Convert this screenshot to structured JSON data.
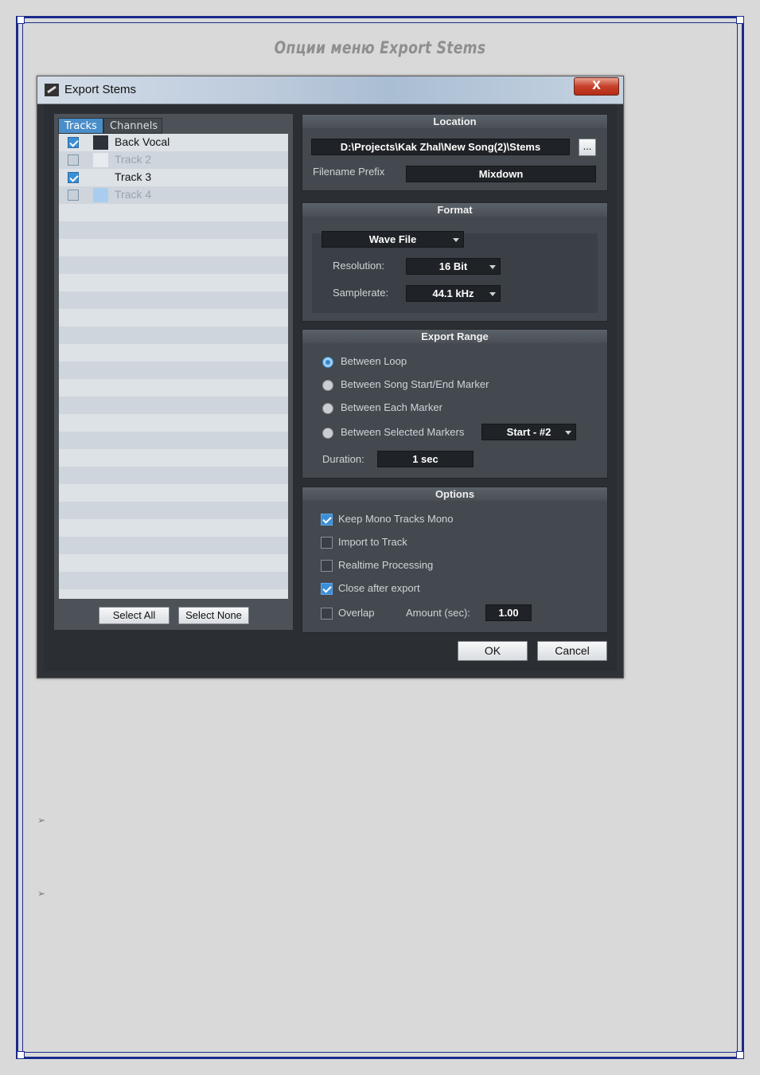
{
  "page": {
    "heading": "Опции меню Export Stems",
    "bullets": [
      "➢",
      "➢"
    ]
  },
  "dialog": {
    "title": "Export Stems",
    "close_label": "X",
    "tabs": [
      "Tracks",
      "Channels"
    ],
    "active_tab": "Tracks",
    "tracks": [
      {
        "name": "Back Vocal",
        "checked": true,
        "enabled": true,
        "color": "#2b323a"
      },
      {
        "name": "Track 2",
        "checked": false,
        "enabled": false,
        "color": "#e8ebee"
      },
      {
        "name": "Track 3",
        "checked": true,
        "enabled": true,
        "color": "#dde2e7"
      },
      {
        "name": "Track 4",
        "checked": false,
        "enabled": false,
        "color": "#a9cdef"
      }
    ],
    "select_all_label": "Select All",
    "select_none_label": "Select None",
    "location": {
      "heading": "Location",
      "path": "D:\\Projects\\Kak Zhal\\New Song(2)\\Stems",
      "browse_label": "...",
      "prefix_label": "Filename Prefix",
      "prefix_value": "Mixdown"
    },
    "format": {
      "heading": "Format",
      "file_type": "Wave File",
      "resolution_label": "Resolution:",
      "resolution_value": "16 Bit",
      "samplerate_label": "Samplerate:",
      "samplerate_value": "44.1 kHz"
    },
    "export_range": {
      "heading": "Export Range",
      "options": [
        "Between Loop",
        "Between Song Start/End Marker",
        "Between Each Marker",
        "Between Selected Markers"
      ],
      "selected": "Between Loop",
      "marker_value": "Start - #2",
      "duration_label": "Duration:",
      "duration_value": "1 sec"
    },
    "options": {
      "heading": "Options",
      "keep_mono": {
        "label": "Keep Mono Tracks Mono",
        "checked": true
      },
      "import_to_track": {
        "label": "Import to Track",
        "checked": false
      },
      "realtime": {
        "label": "Realtime Processing",
        "checked": false
      },
      "close_after": {
        "label": "Close after export",
        "checked": true
      },
      "overlap": {
        "label": "Overlap",
        "checked": false
      },
      "amount_label": "Amount (sec):",
      "amount_value": "1.00"
    },
    "ok_label": "OK",
    "cancel_label": "Cancel"
  }
}
